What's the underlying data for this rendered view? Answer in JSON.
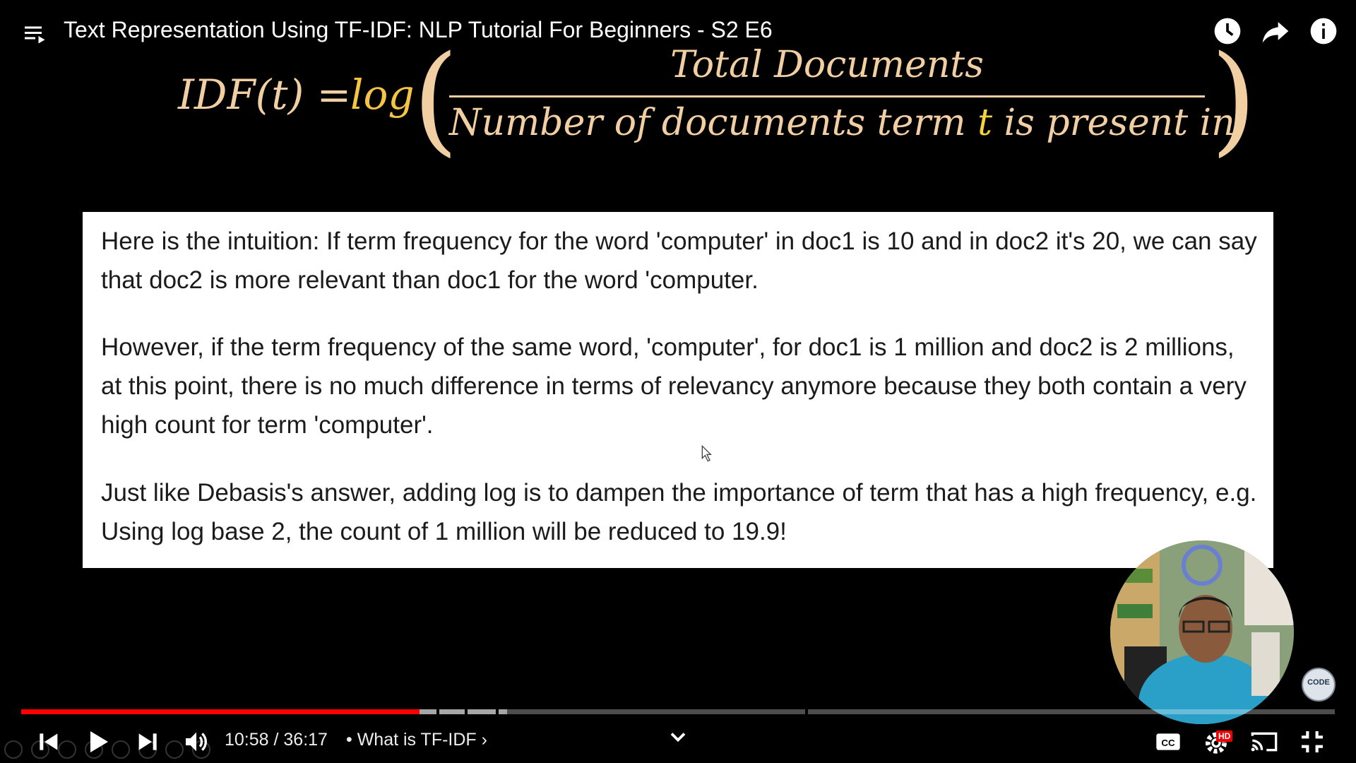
{
  "header": {
    "title": "Text Representation Using TF-IDF: NLP Tutorial For Beginners - S2 E6",
    "icons": [
      "playlist-icon",
      "watch-later-icon",
      "share-icon",
      "info-icon"
    ]
  },
  "formula": {
    "lhs": "IDF(t) =",
    "log": "log",
    "numerator": "Total Documents",
    "denominator_before": "Number of documents term ",
    "denominator_term": "t",
    "denominator_after": " is present in"
  },
  "slide": {
    "paragraphs": [
      "Here is the intuition: If term frequency for the word 'computer' in doc1 is 10 and in doc2 it's 20, we can say that doc2 is more relevant than doc1 for the word 'computer.",
      "However, if the term frequency of the same word, 'computer', for doc1 is 1 million and doc2 is 2 millions, at this point, there is no much difference in terms of relevancy anymore because they both contain a very high count for term 'computer'.",
      "Just like Debasis's answer, adding log is to dampen the importance of term that has a high frequency, e.g. Using log base 2, the count of 1 million will be reduced to 19.9!"
    ]
  },
  "channel_logo": {
    "text": "CODE"
  },
  "player": {
    "time": "10:58 / 36:17",
    "chapter": "• What is TF-IDF ›",
    "played_fraction": 0.303,
    "buffered_fraction": 0.37,
    "quality_badge": "HD",
    "colors": {
      "played": "#ff0000",
      "formula": "#f2cfa2",
      "log": "#f5c443"
    },
    "icons": [
      "previous-icon",
      "play-icon",
      "next-icon",
      "volume-icon",
      "chevron-down-icon",
      "captions-icon",
      "settings-icon",
      "cast-icon",
      "exit-fullscreen-icon"
    ]
  }
}
